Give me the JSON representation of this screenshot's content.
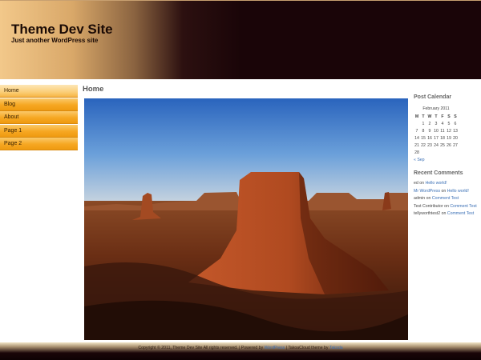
{
  "header": {
    "site_title": "Theme Dev Site",
    "tagline": "Just another WordPress site"
  },
  "nav": {
    "items": [
      {
        "label": "Home"
      },
      {
        "label": "Blog"
      },
      {
        "label": "About"
      },
      {
        "label": "Page 1"
      },
      {
        "label": "Page 2"
      }
    ]
  },
  "main": {
    "title": "Home"
  },
  "calendar": {
    "heading": "Post Calendar",
    "caption": "February 2011",
    "days": [
      "M",
      "T",
      "W",
      "T",
      "F",
      "S",
      "S"
    ],
    "weeks": [
      [
        "",
        "1",
        "2",
        "3",
        "4",
        "5",
        "6"
      ],
      [
        "7",
        "8",
        "9",
        "10",
        "11",
        "12",
        "13"
      ],
      [
        "14",
        "15",
        "16",
        "17",
        "18",
        "19",
        "20"
      ],
      [
        "21",
        "22",
        "23",
        "24",
        "25",
        "26",
        "27"
      ],
      [
        "28",
        "",
        "",
        "",
        "",
        "",
        ""
      ]
    ],
    "prev_link": "« Sep"
  },
  "recent_comments": {
    "heading": "Recent Comments",
    "items": [
      {
        "author": "ed",
        "on": "on",
        "post": "Hello world!"
      },
      {
        "author": "Mr WordPress",
        "on": "on",
        "post": "Hello world!"
      },
      {
        "author": "admin",
        "on": "on",
        "post": "Comment Test"
      },
      {
        "author": "Test Contributor",
        "on": "on",
        "post": "Comment Test"
      },
      {
        "author": "tellyworthtest2",
        "on": "on",
        "post": "Comment Test"
      }
    ]
  },
  "footer": {
    "copyright": "Copyright © 2011, Theme Dev Site All rights reserved. | Powered by",
    "wp_link": "WordPress",
    "middle": "| TakoaCloud theme by",
    "author_link": "Takoda"
  }
}
